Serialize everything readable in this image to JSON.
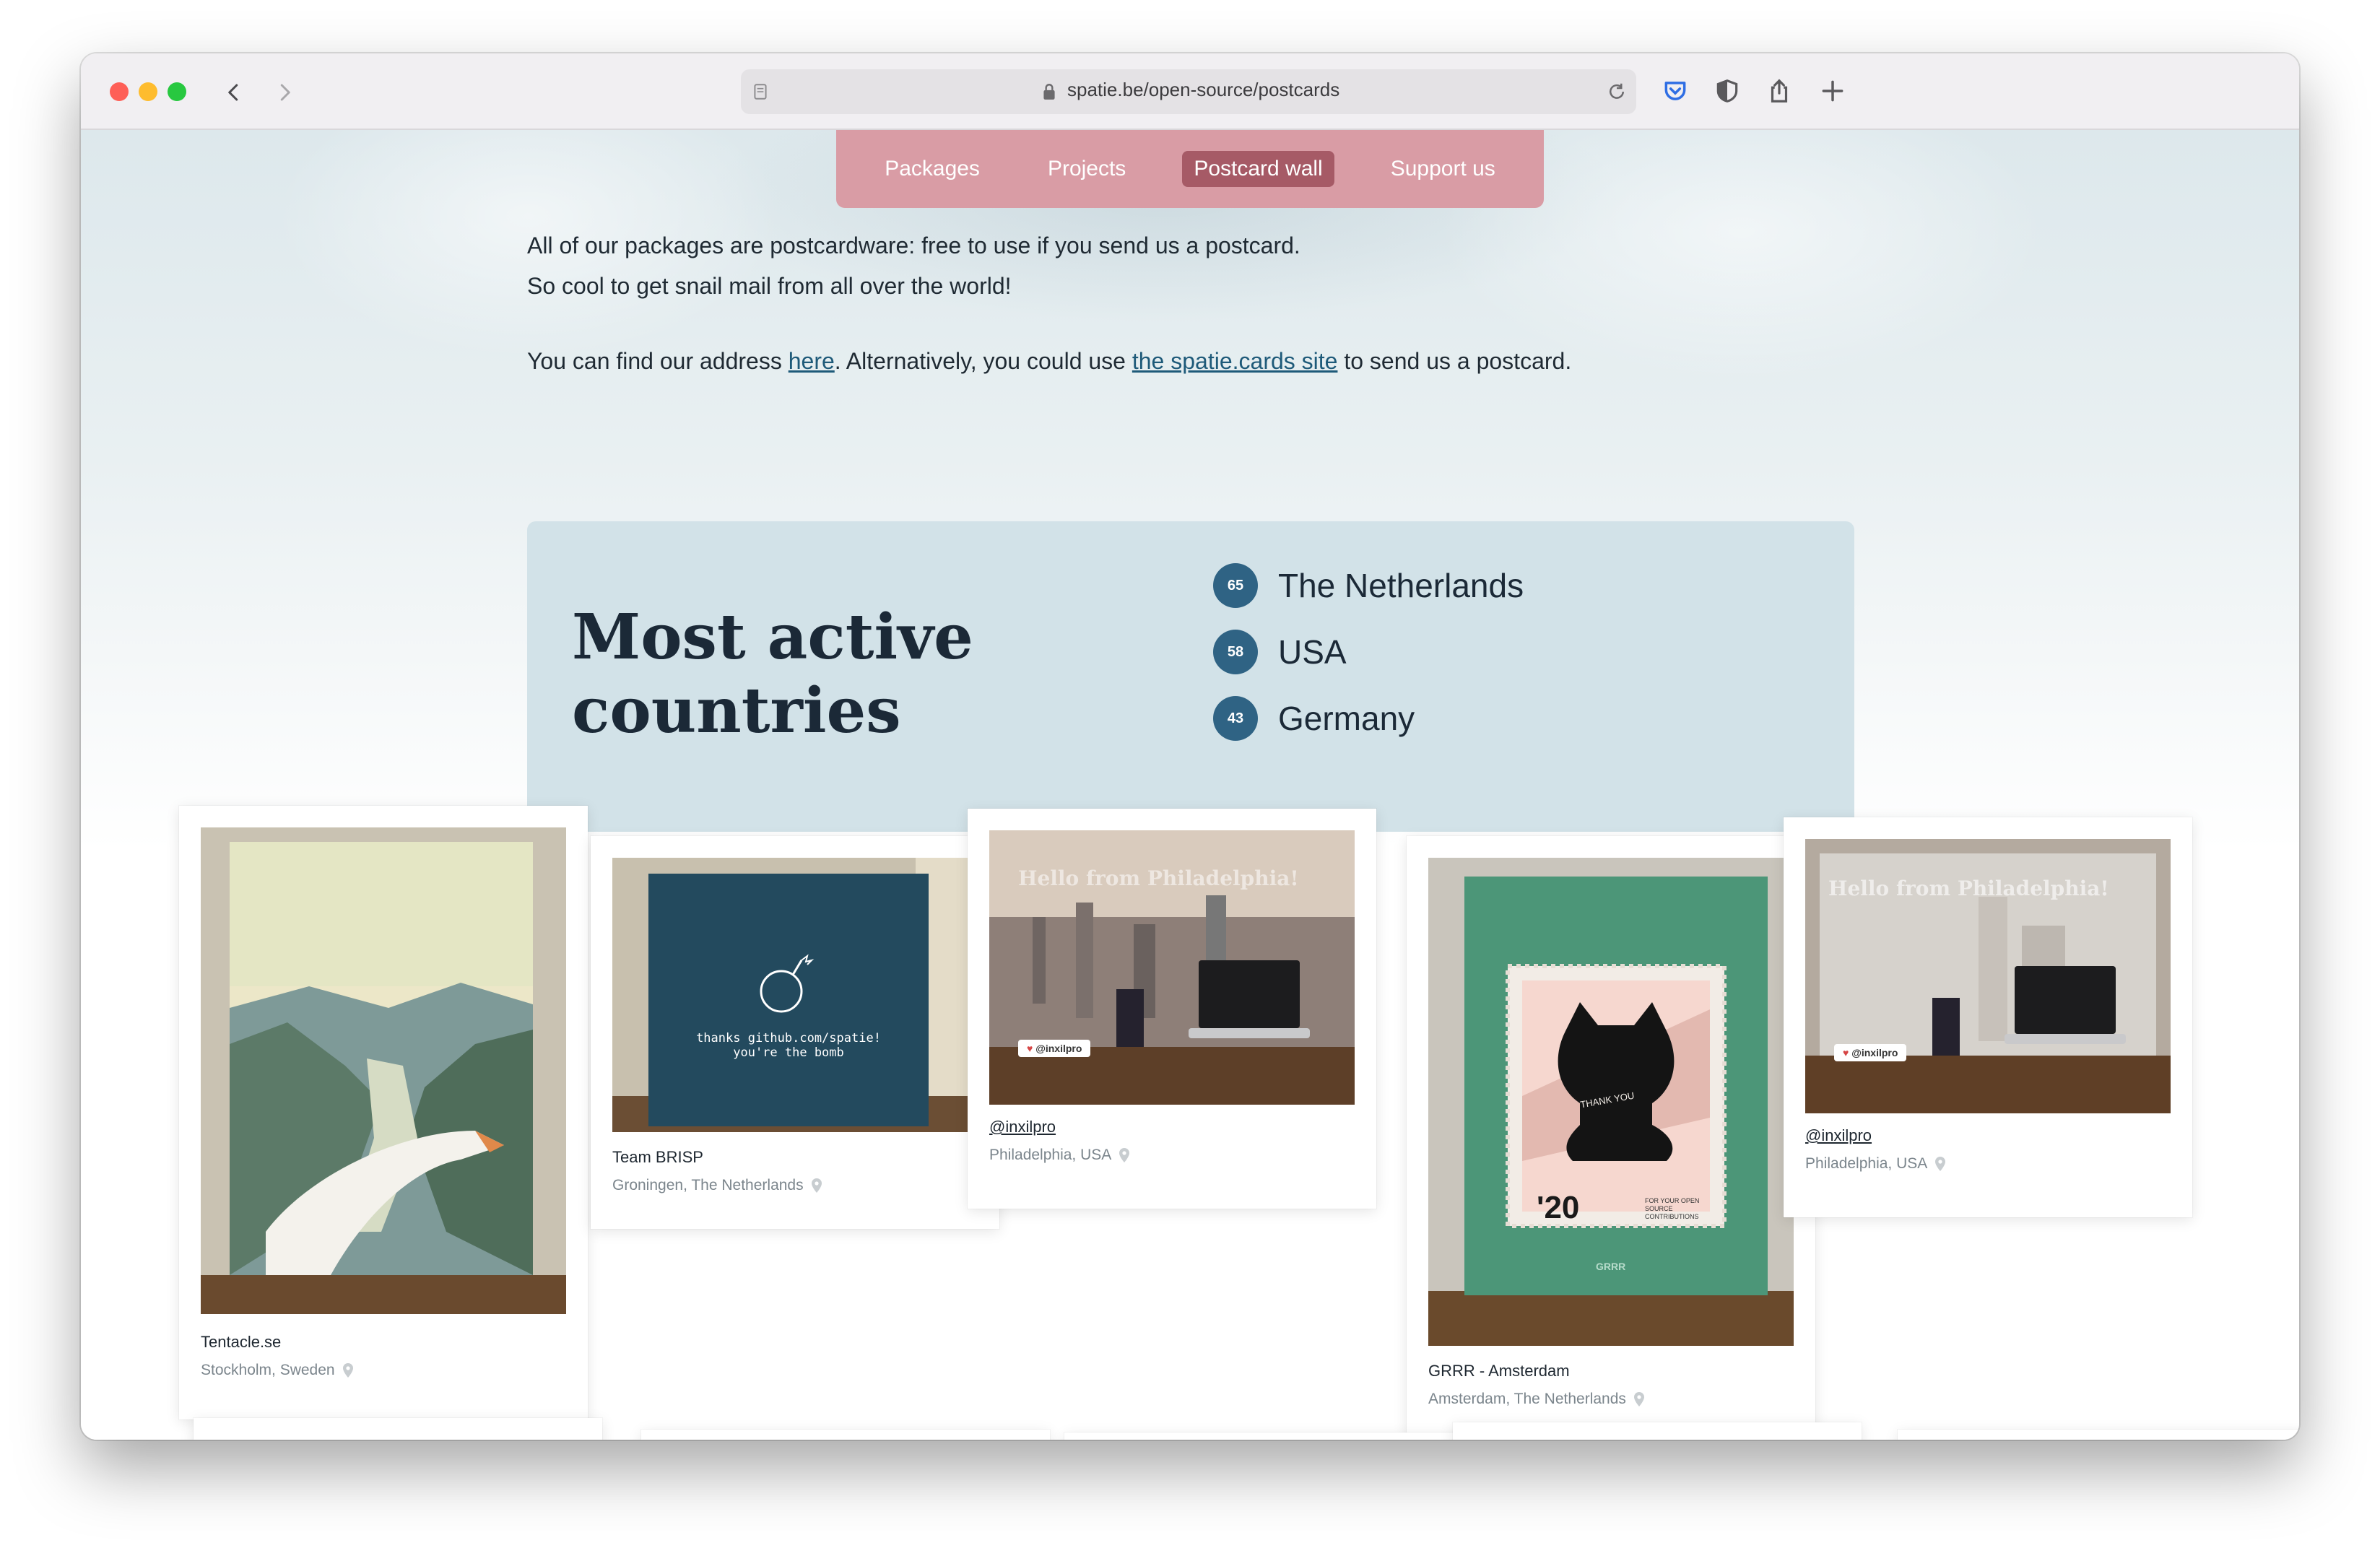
{
  "browser": {
    "url": "spatie.be/open-source/postcards"
  },
  "nav": {
    "items": [
      {
        "label": "Packages"
      },
      {
        "label": "Projects"
      },
      {
        "label": "Postcard wall"
      },
      {
        "label": "Support us"
      }
    ]
  },
  "intro": {
    "line1": "All of our packages are postcardware: free to use if you send us a postcard.",
    "line2": "So cool to get snail mail from all over the world!",
    "address_prefix": "You can find our address ",
    "address_link": "here",
    "address_middle": ". Alternatively, you could use ",
    "site_link": "the spatie.cards site",
    "address_suffix": " to send us a postcard."
  },
  "countries": {
    "title_line1": "Most active",
    "title_line2": "countries",
    "list": [
      {
        "count": "65",
        "name": "The Netherlands"
      },
      {
        "count": "58",
        "name": "USA"
      },
      {
        "count": "43",
        "name": "Germany"
      }
    ]
  },
  "postcards": [
    {
      "title": "Tentacle.se",
      "location": "Stockholm, Sweden"
    },
    {
      "title": "Team BRISP",
      "location": "Groningen, The Netherlands",
      "card_text_1": "thanks github.com/spatie!",
      "card_text_2": "you're the bomb"
    },
    {
      "title": "@inxilpro",
      "location": "Philadelphia, USA",
      "card_text": "Hello from Philadelphia!",
      "tag": "@inxilpro"
    },
    {
      "title": "GRRR - Amsterdam",
      "location": "Amsterdam, The Netherlands",
      "stamp_year": "'20",
      "stamp_text": "THANK YOU",
      "stamp_small": "FOR YOUR OPEN SOURCE CONTRIBUTIONS",
      "brand": "GRRR"
    },
    {
      "title": "@inxilpro",
      "location": "Philadelphia, USA",
      "card_text": "Hello from Philadelphia!",
      "tag": "@inxilpro"
    }
  ],
  "colors": {
    "menu_bg": "#d99ca5",
    "menu_active": "#a65a66",
    "badge": "#2f6384",
    "countries_bg": "#d2e2e8",
    "link": "#1e5a79"
  }
}
